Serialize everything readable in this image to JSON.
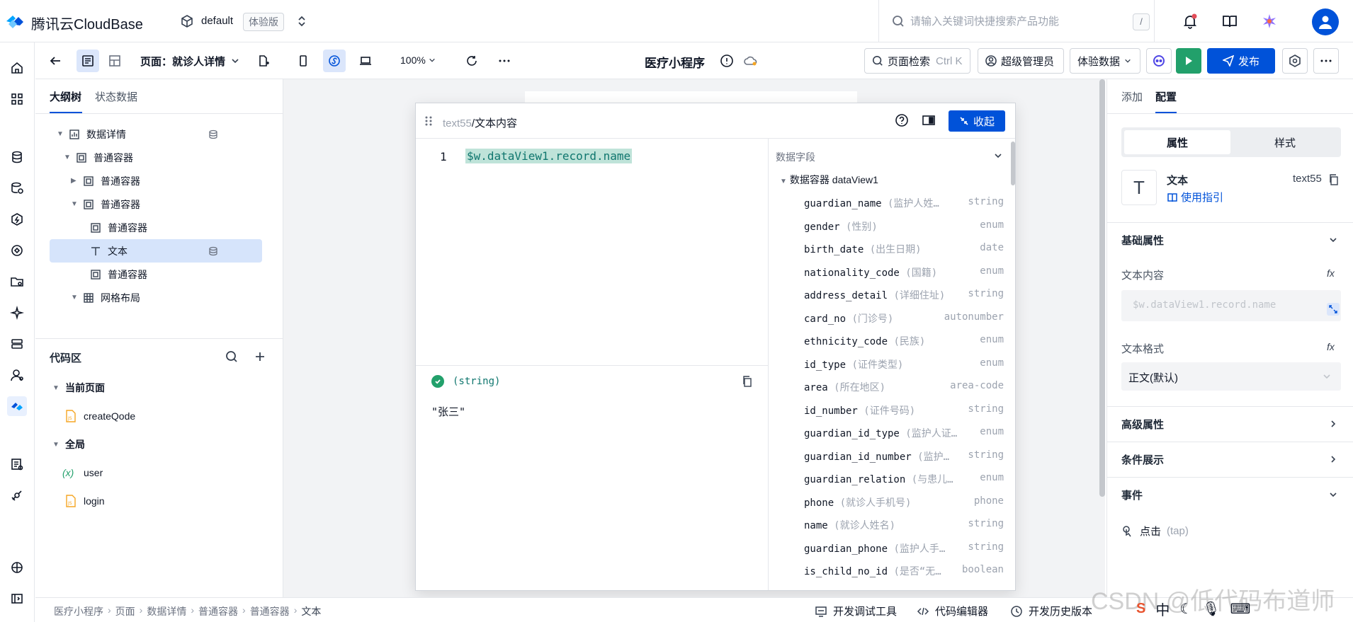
{
  "header": {
    "brand": "腾讯云CloudBase",
    "env_name": "default",
    "env_badge": "体验版",
    "search_placeholder": "请输入关键词快捷搜索产品功能",
    "search_kbd": "/"
  },
  "toolbar": {
    "page_label": "页面：就诊人详情",
    "zoom": "100%",
    "app_title": "医疗小程序",
    "page_search_label": "页面检索",
    "page_search_kbd": "Ctrl K",
    "role_label": "超级管理员",
    "data_mode_label": "体验数据",
    "publish_label": "发布"
  },
  "left_panel": {
    "tabs": [
      "大纲树",
      "状态数据"
    ],
    "tree": [
      {
        "label": "数据详情",
        "depth": 1,
        "arrow": "▼",
        "icon": "chart",
        "db": true
      },
      {
        "label": "普通容器",
        "depth": 2,
        "arrow": "▼",
        "icon": "box"
      },
      {
        "label": "普通容器",
        "depth": 3,
        "arrow": "▶",
        "icon": "box"
      },
      {
        "label": "普通容器",
        "depth": 3,
        "arrow": "▼",
        "icon": "box"
      },
      {
        "label": "普通容器",
        "depth": 4,
        "arrow": "",
        "icon": "box"
      },
      {
        "label": "文本",
        "depth": 4,
        "arrow": "",
        "icon": "text",
        "db": true,
        "selected": true
      },
      {
        "label": "普通容器",
        "depth": 4,
        "arrow": "",
        "icon": "box"
      },
      {
        "label": "网格布局",
        "depth": 3,
        "arrow": "▼",
        "icon": "grid"
      }
    ],
    "code_title": "代码区",
    "code_groups": [
      {
        "label": "当前页面",
        "items": [
          {
            "label": "createQode",
            "icon": "js"
          }
        ]
      },
      {
        "label": "全局",
        "items": [
          {
            "label": "user",
            "icon": "var"
          },
          {
            "label": "login",
            "icon": "js"
          }
        ]
      }
    ]
  },
  "editor": {
    "path_component": "text55",
    "path_sep": "/",
    "path_prop": "文本内容",
    "collapse_label": "收起",
    "line_number": "1",
    "code": "$w.dataView1.record.name",
    "result_type": "(string)",
    "result_value": "\"张三\"",
    "fields_title": "数据字段",
    "fields_root": "数据容器 dataView1",
    "fields": [
      {
        "name": "guardian_name",
        "desc": " (监护人姓…",
        "type": "string"
      },
      {
        "name": "gender",
        "desc": " (性别)",
        "type": "enum"
      },
      {
        "name": "birth_date",
        "desc": " (出生日期)",
        "type": "date"
      },
      {
        "name": "nationality_code",
        "desc": " (国籍)",
        "type": "enum"
      },
      {
        "name": "address_detail",
        "desc": " (详细住址)",
        "type": "string"
      },
      {
        "name": "card_no",
        "desc": " (门诊号)",
        "type": "autonumber"
      },
      {
        "name": "ethnicity_code",
        "desc": " (民族)",
        "type": "enum"
      },
      {
        "name": "id_type",
        "desc": " (证件类型)",
        "type": "enum"
      },
      {
        "name": "area",
        "desc": " (所在地区)",
        "type": "area-code"
      },
      {
        "name": "id_number",
        "desc": " (证件号码)",
        "type": "string"
      },
      {
        "name": "guardian_id_type",
        "desc": " (监护人证…",
        "type": "enum"
      },
      {
        "name": "guardian_id_number",
        "desc": " (监护…",
        "type": "string"
      },
      {
        "name": "guardian_relation",
        "desc": " (与患儿…",
        "type": "enum"
      },
      {
        "name": "phone",
        "desc": " (就诊人手机号)",
        "type": "phone"
      },
      {
        "name": "name",
        "desc": " (就诊人姓名)",
        "type": "string"
      },
      {
        "name": "guardian_phone",
        "desc": " (监护人手…",
        "type": "string"
      },
      {
        "name": "is_child_no_id",
        "desc": " (是否“无…",
        "type": "boolean"
      }
    ]
  },
  "right_panel": {
    "tabs": [
      "添加",
      "配置"
    ],
    "segments": [
      "属性",
      "样式"
    ],
    "component_name": "文本",
    "component_guide": "使用指引",
    "component_id": "text55",
    "basic_section": "基础属性",
    "text_content_label": "文本内容",
    "text_content_value": "$w.dataView1.record.name",
    "text_format_label": "文本格式",
    "text_format_value": "正文(默认)",
    "advanced_section": "高级属性",
    "condition_section": "条件展示",
    "events_section": "事件",
    "event_name": "点击",
    "event_code": "(tap)"
  },
  "bottom": {
    "breadcrumb": [
      "医疗小程序",
      "页面",
      "数据详情",
      "普通容器",
      "普通容器",
      "文本"
    ],
    "debug_tool": "开发调试工具",
    "code_editor": "代码编辑器",
    "history": "开发历史版本"
  },
  "watermark": "CSDN @低代码布道师",
  "tray": {
    "ime": "中"
  }
}
